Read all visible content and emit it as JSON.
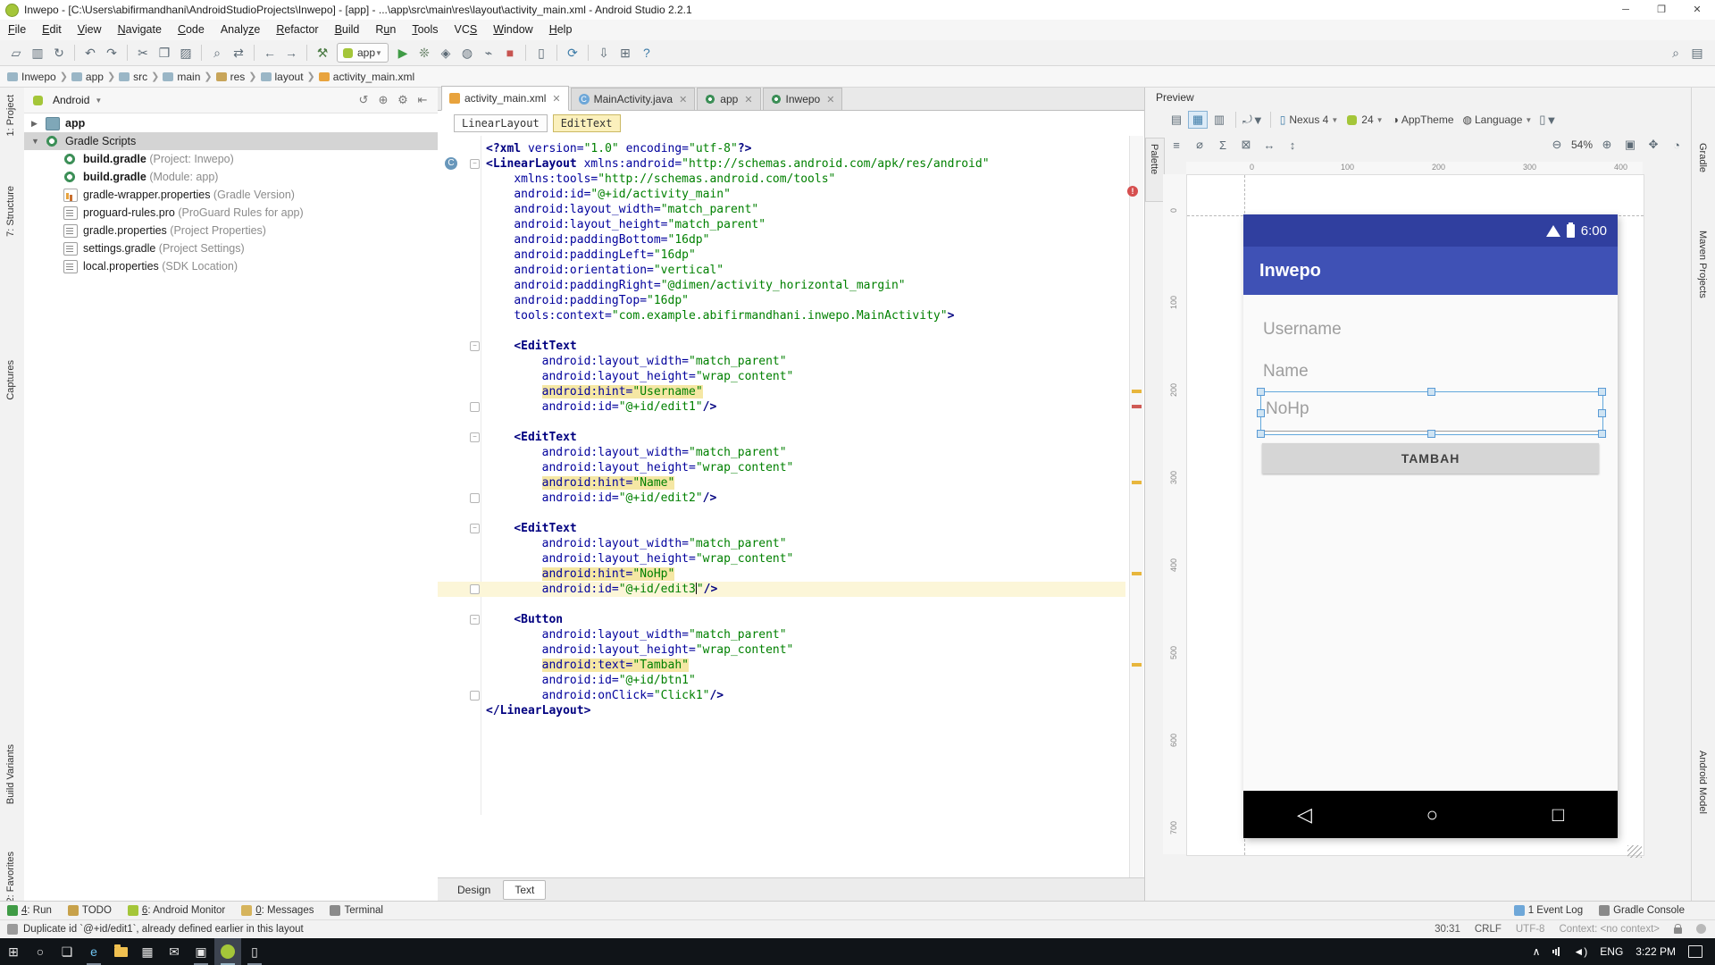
{
  "window": {
    "title": "Inwepo - [C:\\Users\\abifirmandhani\\AndroidStudioProjects\\Inwepo] - [app] - ...\\app\\src\\main\\res\\layout\\activity_main.xml - Android Studio 2.2.1",
    "controls": [
      "minimize",
      "maximize",
      "close"
    ]
  },
  "menubar": {
    "items": [
      {
        "label": "File",
        "m": 0
      },
      {
        "label": "Edit",
        "m": 0
      },
      {
        "label": "View",
        "m": 0
      },
      {
        "label": "Navigate",
        "m": 0
      },
      {
        "label": "Code",
        "m": 0
      },
      {
        "label": "Analyze",
        "m": 5
      },
      {
        "label": "Refactor",
        "m": 0
      },
      {
        "label": "Build",
        "m": 0
      },
      {
        "label": "Run",
        "m": 1
      },
      {
        "label": "Tools",
        "m": 0
      },
      {
        "label": "VCS",
        "m": 2
      },
      {
        "label": "Window",
        "m": 0
      },
      {
        "label": "Help",
        "m": 0
      }
    ]
  },
  "toolbar": {
    "run_config": "app",
    "items": [
      {
        "n": "open-icon",
        "g": "▱"
      },
      {
        "n": "save-all-icon",
        "g": "▥"
      },
      {
        "n": "sync-icon",
        "g": "↻"
      },
      {
        "n": "sep"
      },
      {
        "n": "undo-icon",
        "g": "↶"
      },
      {
        "n": "redo-icon",
        "g": "↷"
      },
      {
        "n": "sep"
      },
      {
        "n": "cut-icon",
        "g": "✂"
      },
      {
        "n": "copy-icon",
        "g": "❐"
      },
      {
        "n": "paste-icon",
        "g": "▨"
      },
      {
        "n": "sep"
      },
      {
        "n": "find-icon",
        "g": "⌕"
      },
      {
        "n": "replace-icon",
        "g": "⇄"
      },
      {
        "n": "sep"
      },
      {
        "n": "back-icon",
        "g": "←"
      },
      {
        "n": "forward-icon",
        "g": "→"
      },
      {
        "n": "sep"
      },
      {
        "n": "build-hammer-icon",
        "g": "⚒",
        "c": "#4a7a43"
      },
      {
        "n": "run-config-chip"
      },
      {
        "n": "run-icon",
        "g": "▶",
        "c": "#3f9b45"
      },
      {
        "n": "debug-icon",
        "g": "❊",
        "c": "#5f7a5f"
      },
      {
        "n": "coverage-icon",
        "g": "◈"
      },
      {
        "n": "profiler-icon",
        "g": "◍"
      },
      {
        "n": "attach-debugger-icon",
        "g": "⌁"
      },
      {
        "n": "stop-icon",
        "g": "■",
        "c": "#c75450"
      },
      {
        "n": "sep"
      },
      {
        "n": "avd-manager-icon",
        "g": "▯"
      },
      {
        "n": "sep"
      },
      {
        "n": "gradle-sync-icon",
        "g": "⟳",
        "c": "#3e7ca8"
      },
      {
        "n": "sep"
      },
      {
        "n": "sdk-manager-icon",
        "g": "⇩"
      },
      {
        "n": "project-structure-icon",
        "g": "⊞"
      },
      {
        "n": "help-icon",
        "g": "?",
        "c": "#3e7ca8"
      }
    ],
    "right_items": [
      {
        "n": "search-everywhere-icon",
        "g": "⌕"
      },
      {
        "n": "tool-window-layout-icon",
        "g": "▤"
      }
    ]
  },
  "breadcrumb": {
    "items": [
      {
        "label": "Inwepo",
        "icon": "folder"
      },
      {
        "label": "app",
        "icon": "folder"
      },
      {
        "label": "src",
        "icon": "folder"
      },
      {
        "label": "main",
        "icon": "folder"
      },
      {
        "label": "res",
        "icon": "res"
      },
      {
        "label": "layout",
        "icon": "folder"
      },
      {
        "label": "activity_main.xml",
        "icon": "xml"
      }
    ]
  },
  "left_stripe": {
    "top": [
      "1: Project",
      "7: Structure",
      "Captures"
    ],
    "bottom": [
      "Build Variants",
      "2: Favorites"
    ]
  },
  "right_stripe": {
    "top": [
      "Gradle",
      "Maven Projects"
    ],
    "bottom": [
      "Android Model"
    ]
  },
  "project_panel": {
    "view_selector": "Android",
    "header_icons": [
      "switch-view-icon",
      "locate-icon",
      "settings-icon",
      "collapse-all-icon"
    ],
    "header_glyphs": [
      "↺",
      "⊕",
      "⚙",
      "⇤"
    ],
    "tree": [
      {
        "label": "app",
        "ann": "",
        "icon": "folder",
        "lvl": 0,
        "arrow": "▶",
        "bold": true
      },
      {
        "label": "Gradle Scripts",
        "ann": "",
        "icon": "gradle",
        "lvl": 0,
        "arrow": "▼",
        "sel": true
      },
      {
        "label": "build.gradle",
        "ann": " (Project: Inwepo)",
        "icon": "gradle",
        "lvl": 1,
        "bold": true
      },
      {
        "label": "build.gradle",
        "ann": " (Module: app)",
        "icon": "gradle",
        "lvl": 1,
        "bold": true
      },
      {
        "label": "gradle-wrapper.properties",
        "ann": " (Gradle Version)",
        "icon": "chart",
        "lvl": 1
      },
      {
        "label": "proguard-rules.pro",
        "ann": " (ProGuard Rules for app)",
        "icon": "file",
        "lvl": 1
      },
      {
        "label": "gradle.properties",
        "ann": " (Project Properties)",
        "icon": "file",
        "lvl": 1
      },
      {
        "label": "settings.gradle",
        "ann": " (Project Settings)",
        "icon": "file",
        "lvl": 1
      },
      {
        "label": "local.properties",
        "ann": " (SDK Location)",
        "icon": "file",
        "lvl": 1
      }
    ]
  },
  "editor": {
    "tabs": [
      {
        "label": "activity_main.xml",
        "icon": "xml-file",
        "active": true
      },
      {
        "label": "MainActivity.java",
        "icon": "java-class"
      },
      {
        "label": "app",
        "icon": "gradle"
      },
      {
        "label": "Inwepo",
        "icon": "gradle"
      }
    ],
    "chips": [
      {
        "label": "LinearLayout"
      },
      {
        "label": "EditText",
        "hl": true
      }
    ],
    "bottom_tabs": [
      {
        "label": "Design"
      },
      {
        "label": "Text",
        "active": true
      }
    ],
    "current_line": 30,
    "fold_start_lines": [
      2,
      14,
      20,
      26,
      32
    ],
    "fold_end_lines": [
      18,
      24,
      30,
      37
    ],
    "class_icon_line": 2,
    "stripe_warn_lines": [
      17,
      23,
      29,
      35
    ],
    "stripe_error_lines": [
      18
    ],
    "code_lines": [
      {
        "segs": [
          [
            "<?xml ",
            "t"
          ],
          [
            "version=",
            "a"
          ],
          [
            "\"1.0\"",
            "v"
          ],
          [
            " ",
            "p"
          ],
          [
            "encoding=",
            "a"
          ],
          [
            "\"utf-8\"",
            "v"
          ],
          [
            "?>",
            "t"
          ]
        ]
      },
      {
        "segs": [
          [
            "<LinearLayout ",
            "t"
          ],
          [
            "xmlns:android=",
            "a"
          ],
          [
            "\"http://schemas.android.com/apk/res/android\"",
            "v"
          ]
        ]
      },
      {
        "segs": [
          [
            "    ",
            "p"
          ],
          [
            "xmlns:tools=",
            "a"
          ],
          [
            "\"http://schemas.android.com/tools\"",
            "v"
          ]
        ]
      },
      {
        "segs": [
          [
            "    ",
            "p"
          ],
          [
            "android:id=",
            "a"
          ],
          [
            "\"@+id/activity_main\"",
            "v"
          ]
        ]
      },
      {
        "segs": [
          [
            "    ",
            "p"
          ],
          [
            "android:layout_width=",
            "a"
          ],
          [
            "\"match_parent\"",
            "v"
          ]
        ]
      },
      {
        "segs": [
          [
            "    ",
            "p"
          ],
          [
            "android:layout_height=",
            "a"
          ],
          [
            "\"match_parent\"",
            "v"
          ]
        ]
      },
      {
        "segs": [
          [
            "    ",
            "p"
          ],
          [
            "android:paddingBottom=",
            "a"
          ],
          [
            "\"16dp\"",
            "v"
          ]
        ]
      },
      {
        "segs": [
          [
            "    ",
            "p"
          ],
          [
            "android:paddingLeft=",
            "a"
          ],
          [
            "\"16dp\"",
            "v"
          ]
        ]
      },
      {
        "segs": [
          [
            "    ",
            "p"
          ],
          [
            "android:orientation=",
            "a"
          ],
          [
            "\"vertical\"",
            "v"
          ]
        ]
      },
      {
        "segs": [
          [
            "    ",
            "p"
          ],
          [
            "android:paddingRight=",
            "a"
          ],
          [
            "\"@dimen/activity_horizontal_margin\"",
            "v"
          ]
        ]
      },
      {
        "segs": [
          [
            "    ",
            "p"
          ],
          [
            "android:paddingTop=",
            "a"
          ],
          [
            "\"16dp\"",
            "v"
          ]
        ]
      },
      {
        "segs": [
          [
            "    ",
            "p"
          ],
          [
            "tools:context=",
            "a"
          ],
          [
            "\"com.example.abifirmandhani.inwepo.MainActivity\"",
            "v"
          ],
          [
            ">",
            "t"
          ]
        ]
      },
      {
        "segs": []
      },
      {
        "segs": [
          [
            "    ",
            "p"
          ],
          [
            "<EditText",
            "t"
          ]
        ]
      },
      {
        "segs": [
          [
            "        ",
            "p"
          ],
          [
            "android:layout_width=",
            "a"
          ],
          [
            "\"match_parent\"",
            "v"
          ]
        ]
      },
      {
        "segs": [
          [
            "        ",
            "p"
          ],
          [
            "android:layout_height=",
            "a"
          ],
          [
            "\"wrap_content\"",
            "v"
          ]
        ]
      },
      {
        "segs": [
          [
            "        ",
            "p"
          ],
          [
            "android:hint=",
            "ha"
          ],
          [
            "\"Username\"",
            "hv"
          ]
        ]
      },
      {
        "segs": [
          [
            "        ",
            "p"
          ],
          [
            "android:id=",
            "a"
          ],
          [
            "\"@+id/edit1\"",
            "v"
          ],
          [
            "/>",
            "t"
          ]
        ]
      },
      {
        "segs": []
      },
      {
        "segs": [
          [
            "    ",
            "p"
          ],
          [
            "<EditText",
            "t"
          ]
        ]
      },
      {
        "segs": [
          [
            "        ",
            "p"
          ],
          [
            "android:layout_width=",
            "a"
          ],
          [
            "\"match_parent\"",
            "v"
          ]
        ]
      },
      {
        "segs": [
          [
            "        ",
            "p"
          ],
          [
            "android:layout_height=",
            "a"
          ],
          [
            "\"wrap_content\"",
            "v"
          ]
        ]
      },
      {
        "segs": [
          [
            "        ",
            "p"
          ],
          [
            "android:hint=",
            "ha"
          ],
          [
            "\"Name\"",
            "hv"
          ]
        ]
      },
      {
        "segs": [
          [
            "        ",
            "p"
          ],
          [
            "android:id=",
            "a"
          ],
          [
            "\"@+id/edit2\"",
            "v"
          ],
          [
            "/>",
            "t"
          ]
        ]
      },
      {
        "segs": []
      },
      {
        "segs": [
          [
            "    ",
            "p"
          ],
          [
            "<EditText",
            "t"
          ]
        ]
      },
      {
        "segs": [
          [
            "        ",
            "p"
          ],
          [
            "android:layout_width=",
            "a"
          ],
          [
            "\"match_parent\"",
            "v"
          ]
        ]
      },
      {
        "segs": [
          [
            "        ",
            "p"
          ],
          [
            "android:layout_height=",
            "a"
          ],
          [
            "\"wrap_content\"",
            "v"
          ]
        ]
      },
      {
        "segs": [
          [
            "        ",
            "p"
          ],
          [
            "android:hint=",
            "ha"
          ],
          [
            "\"NoHp\"",
            "hv"
          ]
        ]
      },
      {
        "segs": [
          [
            "        ",
            "p"
          ],
          [
            "android:id=",
            "a"
          ],
          [
            "\"@+id/edit3",
            "v"
          ],
          [
            "",
            "caret"
          ],
          [
            "\"",
            "v"
          ],
          [
            "/>",
            "t"
          ]
        ]
      },
      {
        "segs": []
      },
      {
        "segs": [
          [
            "    ",
            "p"
          ],
          [
            "<Button",
            "t"
          ]
        ]
      },
      {
        "segs": [
          [
            "        ",
            "p"
          ],
          [
            "android:layout_width=",
            "a"
          ],
          [
            "\"match_parent\"",
            "v"
          ]
        ]
      },
      {
        "segs": [
          [
            "        ",
            "p"
          ],
          [
            "android:layout_height=",
            "a"
          ],
          [
            "\"wrap_content\"",
            "v"
          ]
        ]
      },
      {
        "segs": [
          [
            "        ",
            "p"
          ],
          [
            "android:text=",
            "ha"
          ],
          [
            "\"Tambah\"",
            "hv"
          ]
        ]
      },
      {
        "segs": [
          [
            "        ",
            "p"
          ],
          [
            "android:id=",
            "a"
          ],
          [
            "\"@+id/btn1\"",
            "v"
          ]
        ]
      },
      {
        "segs": [
          [
            "        ",
            "p"
          ],
          [
            "android:onClick=",
            "a"
          ],
          [
            "\"Click1\"",
            "v"
          ],
          [
            "/>",
            "t"
          ]
        ]
      },
      {
        "segs": [
          [
            "</LinearLayout>",
            "t"
          ]
        ]
      }
    ]
  },
  "preview": {
    "title": "Preview",
    "device": "Nexus 4",
    "api_level": "24",
    "theme": "AppTheme",
    "language": "Language",
    "zoom": "54%",
    "palette_tab": "Palette",
    "ruler_top": [
      "0",
      "100",
      "200",
      "300",
      "400"
    ],
    "ruler_left": [
      "0",
      "100",
      "200",
      "300",
      "400",
      "500",
      "600",
      "700"
    ],
    "row2_left_glyphs": [
      "≡",
      "⌀",
      "Σ",
      "⊠",
      "↔",
      "↕"
    ],
    "phone": {
      "status_time": "6:00",
      "app_title": "Inwepo",
      "hints": [
        "Username",
        "Name",
        "NoHp"
      ],
      "selected_field_hint": "NoHp",
      "button_label": "TAMBAH",
      "nav": [
        "◁",
        "○",
        "□"
      ],
      "appbar_color": "#3f51b5",
      "statusbar_color": "#303f9f"
    }
  },
  "bottom_bar": {
    "left": [
      {
        "label": "4: Run",
        "m": 0,
        "icon": "run-toolwindow-icon",
        "ic": "#3f9b45"
      },
      {
        "label": "TODO",
        "m": -1,
        "icon": "todo-icon",
        "ic": "#c7a14a"
      },
      {
        "label": "6: Android Monitor",
        "m": 0,
        "icon": "android-monitor-icon",
        "ic": "#a4c639"
      },
      {
        "label": "0: Messages",
        "m": 0,
        "icon": "messages-icon",
        "ic": "#d6b45c"
      },
      {
        "label": "Terminal",
        "m": -1,
        "icon": "terminal-icon",
        "ic": "#8a8a8a"
      }
    ],
    "right": [
      {
        "label": "1 Event Log",
        "icon": "event-log-icon",
        "ic": "#6ea7d8"
      },
      {
        "label": "Gradle Console",
        "icon": "gradle-console-icon",
        "ic": "#8a8a8a"
      }
    ]
  },
  "status_bar": {
    "message": "Duplicate id `@+id/edit1`, already defined earlier in this layout",
    "caret_position": "30:31",
    "line_ending": "CRLF",
    "encoding": "UTF-8",
    "context": "Context: <no context>"
  },
  "taskbar": {
    "items": [
      {
        "n": "start-button",
        "g": "⊞",
        "kind": "glyph"
      },
      {
        "n": "cortana-search-button",
        "g": "○",
        "kind": "glyph"
      },
      {
        "n": "task-view-button",
        "g": "❏",
        "kind": "glyph"
      },
      {
        "n": "edge-icon",
        "g": "e",
        "kind": "glyph",
        "c": "#6fc3f0",
        "open": true
      },
      {
        "n": "file-explorer-icon",
        "kind": "folder"
      },
      {
        "n": "store-icon",
        "g": "▦",
        "kind": "glyph"
      },
      {
        "n": "mail-icon",
        "g": "✉",
        "kind": "glyph"
      },
      {
        "n": "photos-icon",
        "g": "▣",
        "kind": "glyph",
        "open": true
      },
      {
        "n": "android-studio-icon",
        "kind": "droid",
        "active": true
      },
      {
        "n": "device-icon",
        "g": "▯",
        "kind": "glyph",
        "open": true
      }
    ],
    "tray": {
      "language": "ENG",
      "time": "3:22 PM"
    }
  }
}
